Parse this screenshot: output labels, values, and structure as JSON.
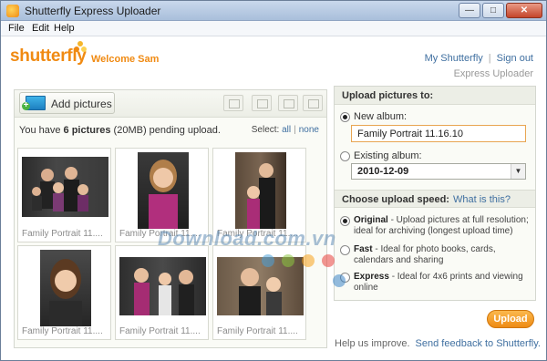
{
  "window": {
    "title": "Shutterfly Express Uploader",
    "buttons": {
      "minimize": "—",
      "maximize": "□",
      "close": "✕"
    }
  },
  "menu": {
    "file": "File",
    "edit": "Edit",
    "help": "Help"
  },
  "header": {
    "logo": "shutterfly",
    "welcome": "Welcome Sam",
    "links": {
      "my_shutterfly": "My Shutterfly",
      "separator": "|",
      "sign_out": "Sign out"
    },
    "subtitle": "Express Uploader"
  },
  "left_panel": {
    "add_pictures": "Add pictures",
    "pending_prefix": "You have ",
    "pending_count": "6 pictures",
    "pending_suffix": " (20MB) pending upload.",
    "select_label": "Select:",
    "select_all": "all",
    "select_sep": "|",
    "select_none": "none",
    "thumbnails": [
      {
        "caption": "Family Portrait 11...."
      },
      {
        "caption": "Family Portrait 11...."
      },
      {
        "caption": "Family Portrait 11...."
      },
      {
        "caption": "Family Portrait 11...."
      },
      {
        "caption": "Family Portrait 11...."
      },
      {
        "caption": "Family Portrait 11...."
      }
    ]
  },
  "right_panel": {
    "upload_to_heading": "Upload pictures to:",
    "new_album_label": "New album:",
    "new_album_value": "Family Portrait 11.16.10",
    "existing_album_label": "Existing album:",
    "existing_album_value": "2010-12-09",
    "speed_heading": "Choose upload speed:",
    "speed_help": "What is this?",
    "speeds": [
      {
        "name": "Original",
        "desc": " - Upload pictures at full resolution; ideal for archiving (longest upload time)",
        "selected": true
      },
      {
        "name": "Fast",
        "desc": " - Ideal for photo books, cards, calendars and sharing",
        "selected": false
      },
      {
        "name": "Express",
        "desc": " - Ideal for 4x6 prints and viewing online",
        "selected": false
      }
    ]
  },
  "upload_button": "Upload",
  "footer": {
    "text": "Help us improve.",
    "link": "Send feedback to Shutterfly."
  },
  "watermark": "Download.com.vn",
  "colors": {
    "brand_orange": "#f08a12",
    "link_blue": "#3f6fa0"
  }
}
